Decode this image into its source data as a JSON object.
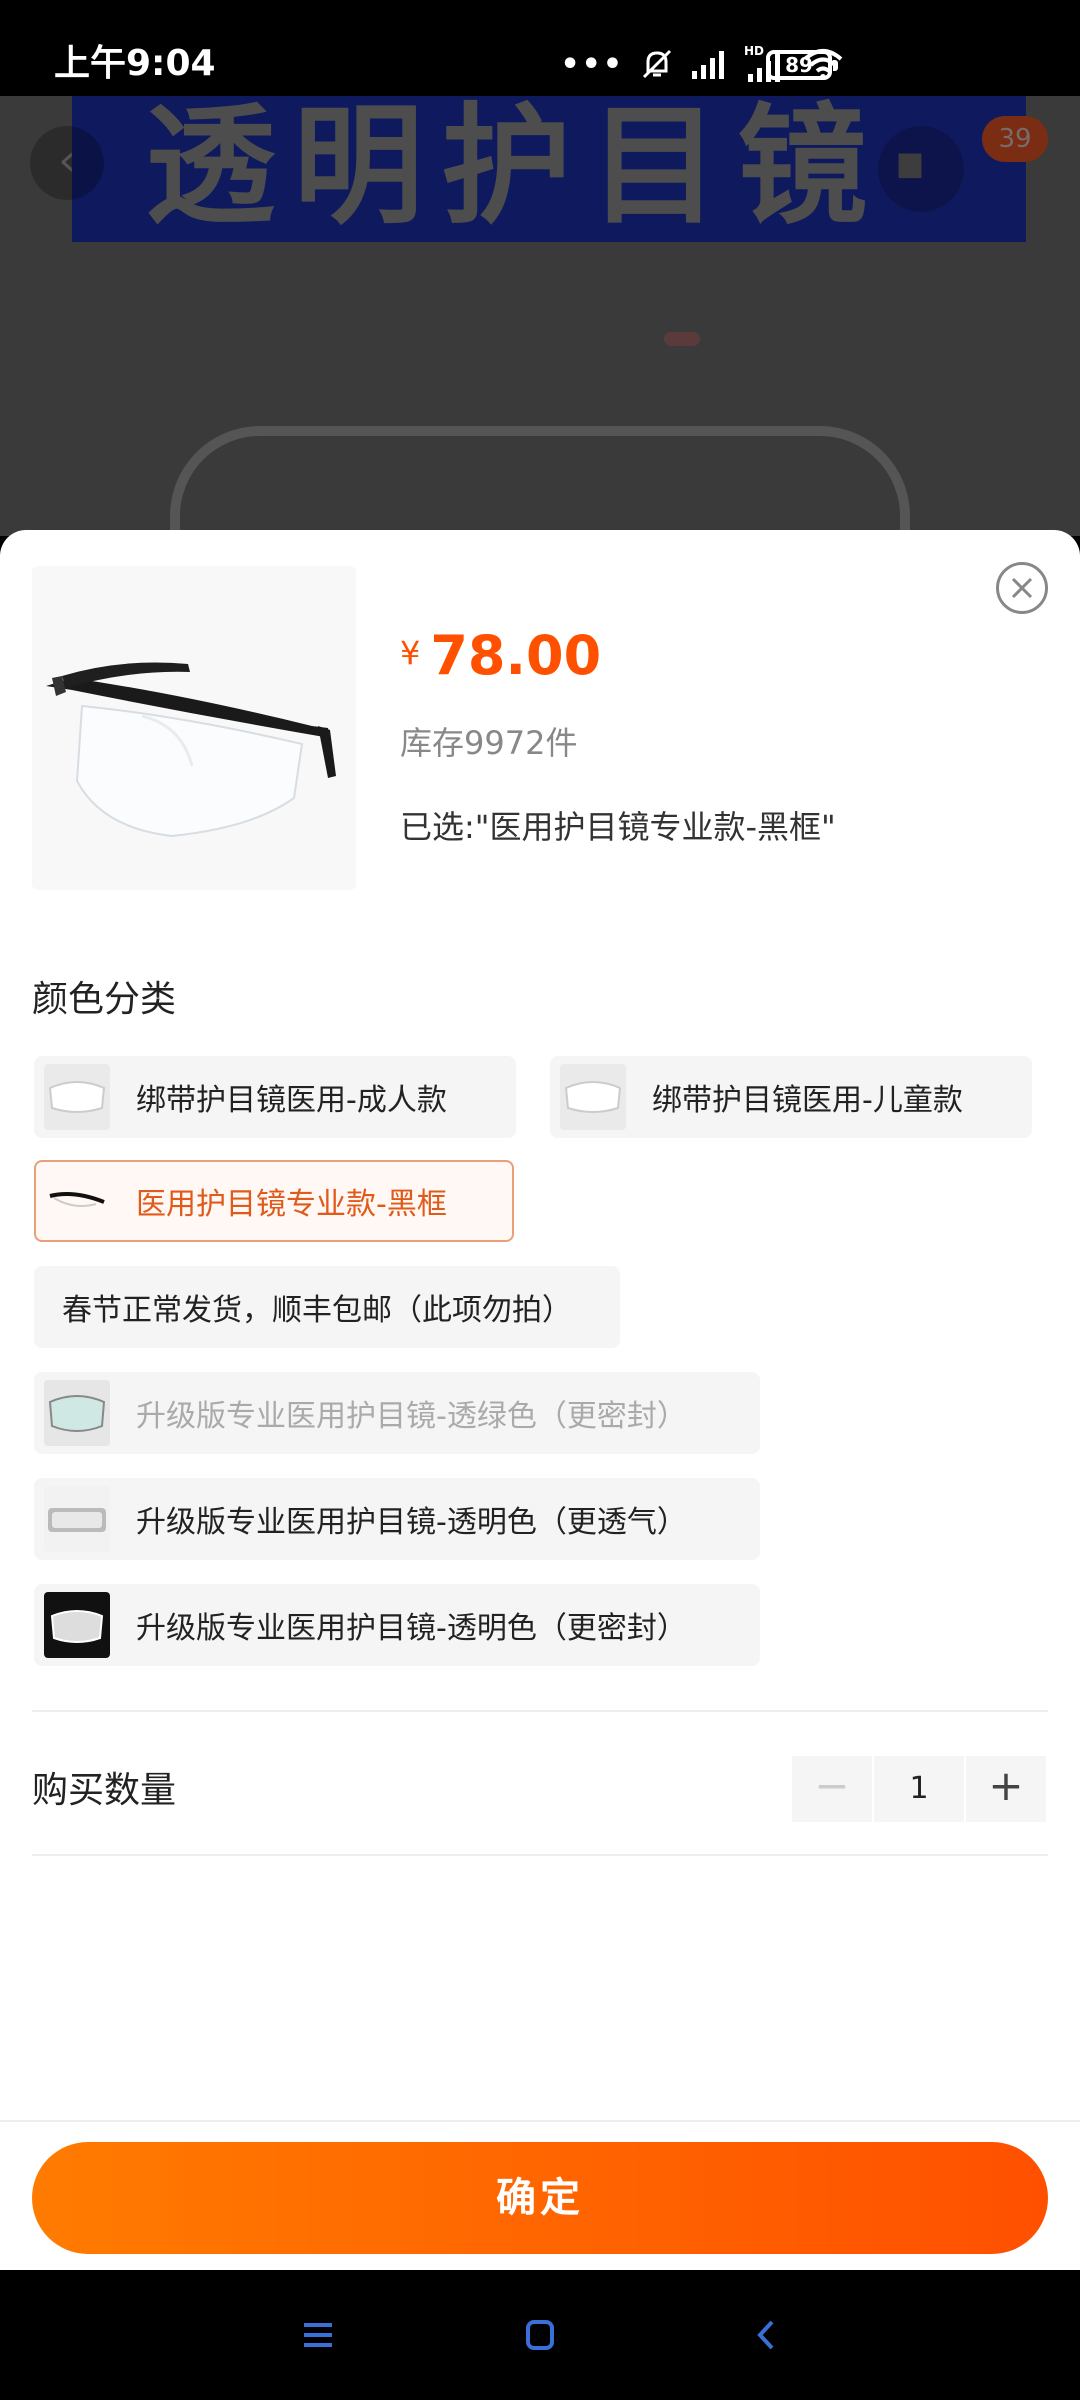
{
  "status_bar": {
    "time": "上午9:04",
    "dots": "•••",
    "network_label": "HD",
    "battery": "89"
  },
  "background": {
    "banner_text": "透明护目镜·",
    "cart_badge": "39"
  },
  "sheet": {
    "price_symbol": "¥",
    "price": "78.00",
    "stock": "库存9972件",
    "selected_text": "已选:\"医用护目镜专业款-黑框\"",
    "section_title": "颜色分类",
    "options": [
      {
        "label": "绑带护目镜医用-成人款",
        "state": "normal"
      },
      {
        "label": "绑带护目镜医用-儿童款",
        "state": "normal"
      },
      {
        "label": "医用护目镜专业款-黑框",
        "state": "selected"
      },
      {
        "label": "春节正常发货，顺丰包邮（此项勿拍）",
        "state": "normal"
      },
      {
        "label": "升级版专业医用护目镜-透绿色（更密封）",
        "state": "disabled"
      },
      {
        "label": "升级版专业医用护目镜-透明色（更透气）",
        "state": "normal"
      },
      {
        "label": "升级版专业医用护目镜-透明色（更密封）",
        "state": "normal"
      }
    ],
    "quantity_label": "购买数量",
    "quantity": "1",
    "minus": "−",
    "plus": "+",
    "confirm": "确定"
  },
  "colors": {
    "accent": "#ff5000",
    "selected_border": "#e8a07a"
  }
}
